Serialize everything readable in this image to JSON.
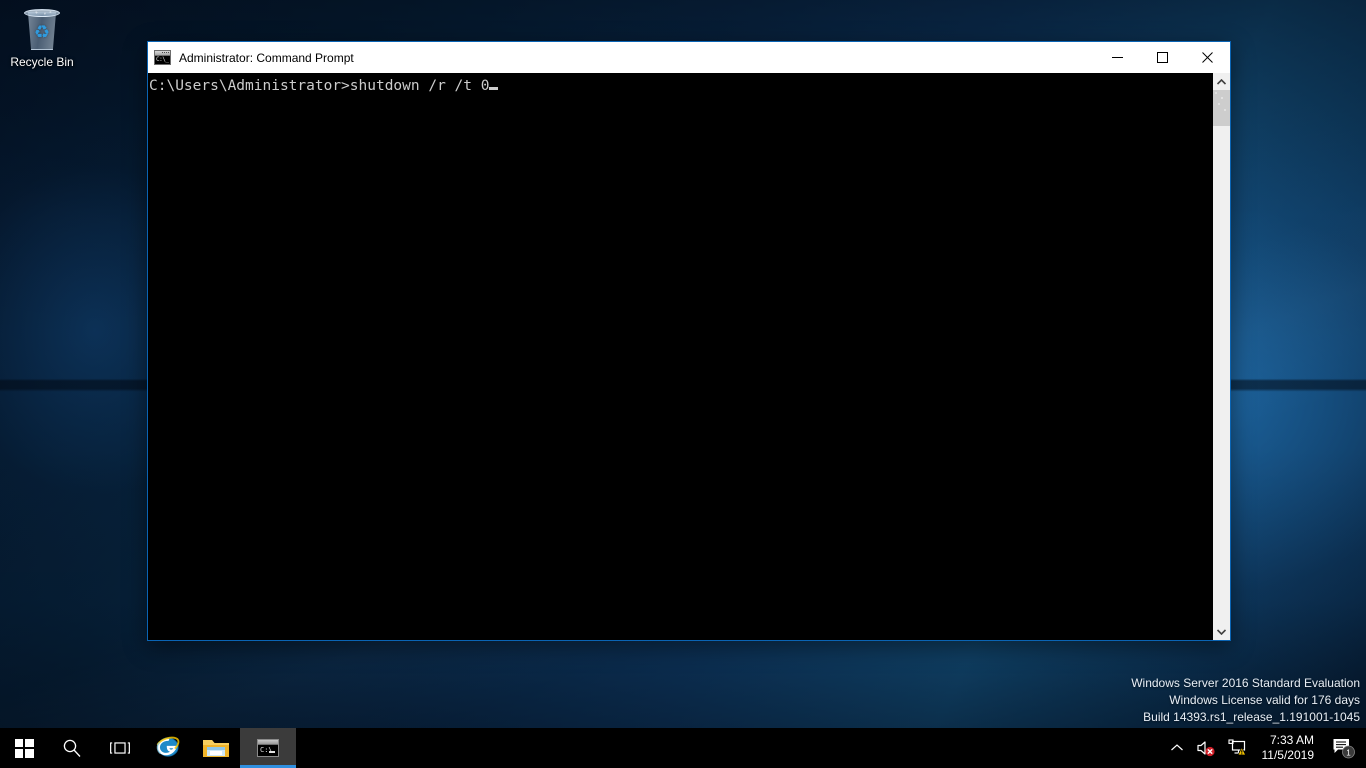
{
  "desktop": {
    "icons": [
      {
        "name": "recycle-bin",
        "label": "Recycle Bin"
      }
    ],
    "watermark": {
      "line1": "Windows Server 2016 Standard Evaluation",
      "line2": "Windows License valid for 176 days",
      "line3": "Build 14393.rs1_release_1.191001-1045"
    },
    "wallpaper_colors": {
      "dark": "#04172e",
      "mid": "#0f3c68",
      "highlight": "#14527f"
    }
  },
  "cmd_window": {
    "title": "Administrator: Command Prompt",
    "icon": "console-icon",
    "controls": {
      "minimize": "minimize-icon",
      "maximize": "maximize-icon",
      "close": "close-icon"
    },
    "console": {
      "prompt": "C:\\Users\\Administrator>",
      "command": "shutdown /r /t 0",
      "full_line": "C:\\Users\\Administrator>shutdown /r /t 0",
      "cursor": "block",
      "background": "#000000",
      "foreground": "#cccccc"
    },
    "scrollbar": {
      "up_arrow": "chevron-up-icon",
      "down_arrow": "chevron-down-icon",
      "thumb_position": "top"
    },
    "border_color": "#0a64b4"
  },
  "taskbar": {
    "start": {
      "name": "start-button",
      "label": "Start"
    },
    "search": {
      "name": "search-button",
      "label": "Search"
    },
    "task_view": {
      "name": "task-view-button",
      "label": "Task View"
    },
    "apps": [
      {
        "name": "internet-explorer",
        "label": "Internet Explorer",
        "active": false
      },
      {
        "name": "file-explorer",
        "label": "File Explorer",
        "active": false
      },
      {
        "name": "command-prompt",
        "label": "Command Prompt",
        "active": true
      }
    ],
    "tray": {
      "show_hidden": "chevron-up-icon",
      "volume": {
        "name": "speaker-muted-icon",
        "state": "muted"
      },
      "network": {
        "name": "network-warning-icon",
        "state": "warning"
      },
      "clock": {
        "time": "7:33 AM",
        "date": "11/5/2019"
      },
      "action_center": {
        "name": "action-center-icon",
        "badge": "1"
      }
    }
  }
}
